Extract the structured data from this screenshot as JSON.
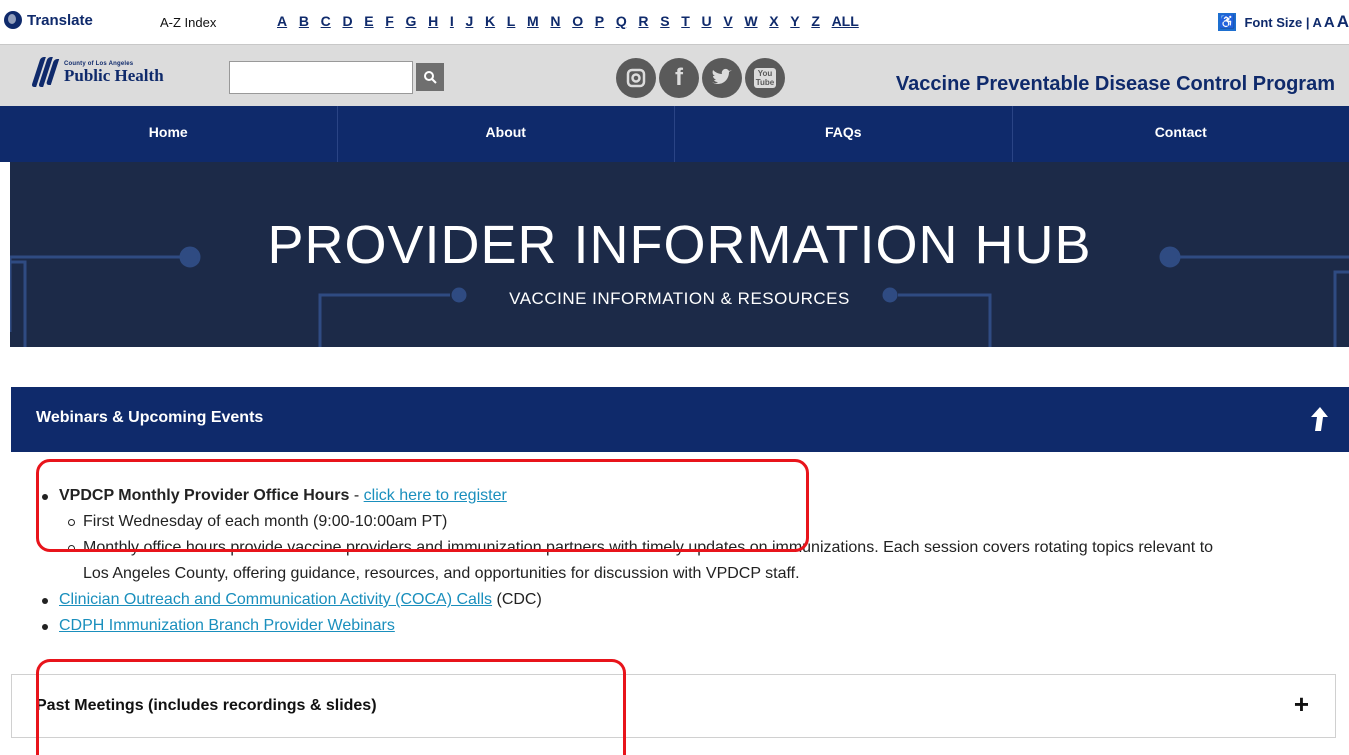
{
  "topbar": {
    "translate_label": "Translate",
    "az_label": "A-Z Index",
    "letters": [
      "A",
      "B",
      "C",
      "D",
      "E",
      "F",
      "G",
      "H",
      "I",
      "J",
      "K",
      "L",
      "M",
      "N",
      "O",
      "P",
      "Q",
      "R",
      "S",
      "T",
      "U",
      "V",
      "W",
      "X",
      "Y",
      "Z",
      "ALL"
    ],
    "font_size_label": "Font Size |",
    "font_size_options": [
      "A",
      "A",
      "A"
    ]
  },
  "header": {
    "logo_small": "County of Los Angeles",
    "logo_big": "Public Health",
    "search_placeholder": "",
    "social_icons": [
      "instagram-icon",
      "facebook-icon",
      "twitter-icon",
      "youtube-icon"
    ],
    "youtube_label": "You Tube",
    "facebook_label": "f",
    "program_title": "Vaccine Preventable Disease Control Program"
  },
  "nav": {
    "items": [
      "Home",
      "About",
      "FAQs",
      "Contact"
    ]
  },
  "hero": {
    "title": "PROVIDER INFORMATION HUB",
    "subtitle": "VACCINE INFORMATION & RESOURCES"
  },
  "events": {
    "header": "Webinars & Upcoming Events",
    "item1_title": "VPDCP Monthly Provider Office Hours",
    "item1_sep": " - ",
    "item1_link": "click here to register",
    "item1_sub1": "First Wednesday of each month (9:00-10:00am PT)",
    "item1_sub2": "Monthly office hours provide vaccine providers and immunization partners with timely updates on immunizations. Each session covers rotating topics relevant to Los Angeles County, offering guidance, resources, and opportunities for discussion with VPDCP staff.",
    "item2_link": "Clinician Outreach and Communication Activity (COCA) Calls",
    "item2_suffix": " (CDC)",
    "item3_link": "CDPH Immunization Branch Provider Webinars"
  },
  "past": {
    "label": "Past Meetings (includes recordings & slides)",
    "toggle": "+"
  },
  "colors": {
    "navy": "#0f2a6b",
    "hero_bg": "#1c2a48",
    "link": "#1a8fbd",
    "callout": "#e8141b"
  }
}
